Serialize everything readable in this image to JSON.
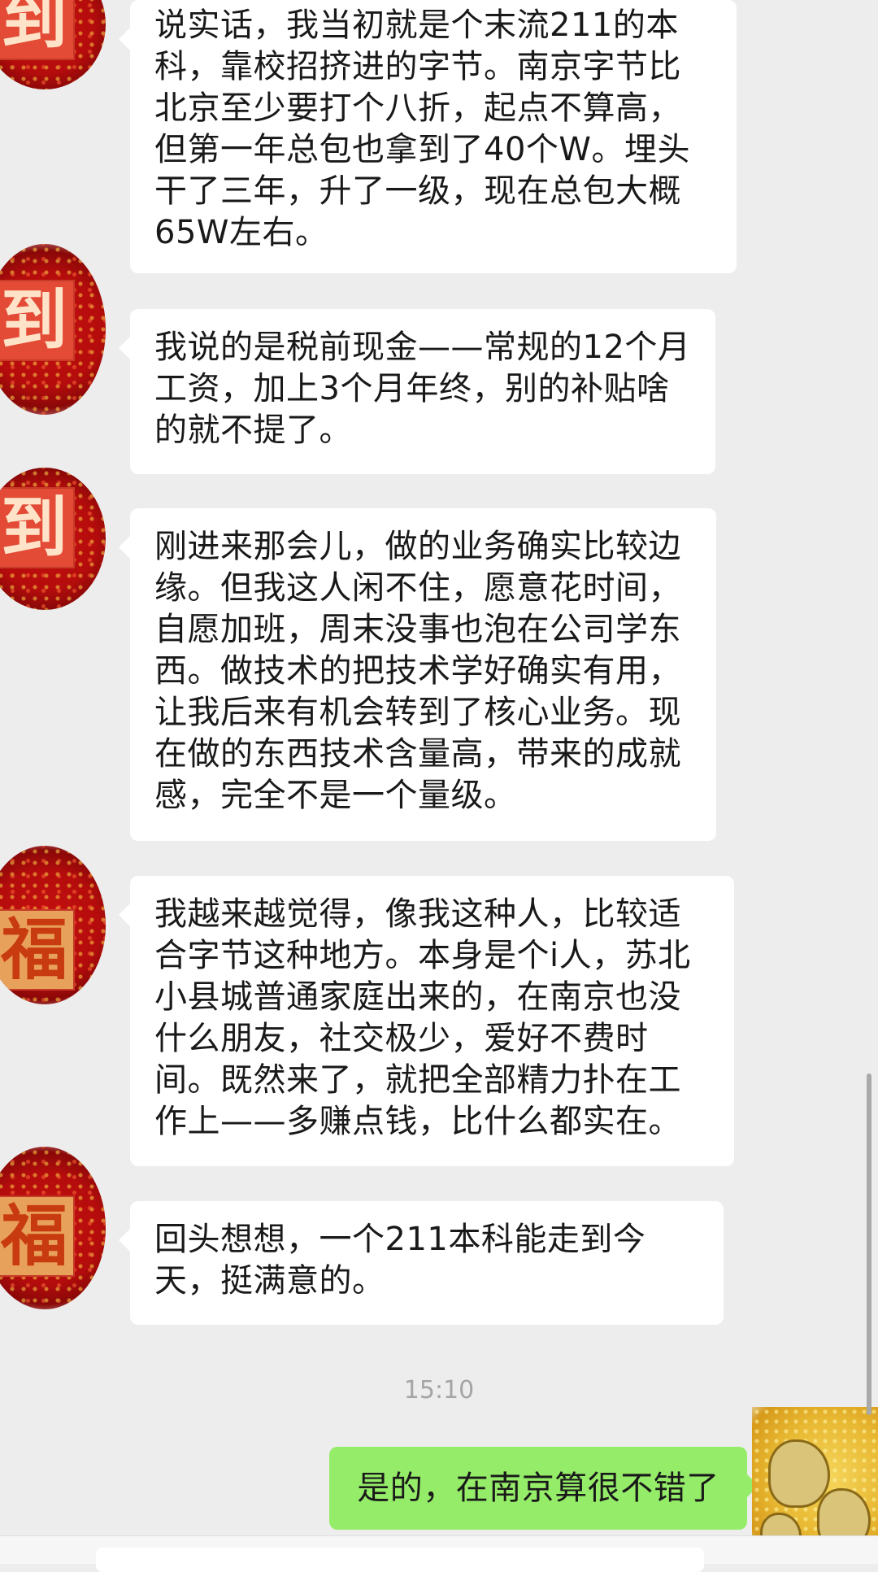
{
  "messages": [
    {
      "text": "说实话，我当初就是个末流211的本科，靠校招挤进的字节。南京字节比北京至少要打个八折，起点不算高，但第一年总包也拿到了40个W。埋头干了三年，升了一级，现在总包大概65W左右。",
      "avatar_glyph": "到"
    },
    {
      "text": "我说的是税前现金——常规的12个月工资，加上3个月年终，别的补贴啥的就不提了。",
      "avatar_glyph": "到"
    },
    {
      "text": "刚进来那会儿，做的业务确实比较边缘。但我这人闲不住，愿意花时间，自愿加班，周末没事也泡在公司学东西。做技术的把技术学好确实有用，让我后来有机会转到了核心业务。现在做的东西技术含量高，带来的成就感，完全不是一个量级。",
      "avatar_glyph": "到"
    },
    {
      "text": "我越来越觉得，像我这种人，比较适合字节这种地方。本身是个i人，苏北小县城普通家庭出来的，在南京也没什么朋友，社交极少，爱好不费时间。既然来了，就把全部精力扑在工作上——多赚点钱，比什么都实在。",
      "avatar_glyph": "福"
    },
    {
      "text": "回头想想，一个211本科能走到今天，挺满意的。",
      "avatar_glyph": "福"
    }
  ],
  "timestamp": "15:10",
  "self_message": {
    "text": "是的，在南京算很不错了"
  },
  "colors": {
    "background": "#ededed",
    "incoming_bubble": "#ffffff",
    "outgoing_bubble": "#95ec69",
    "timestamp": "#a5a5a5"
  }
}
